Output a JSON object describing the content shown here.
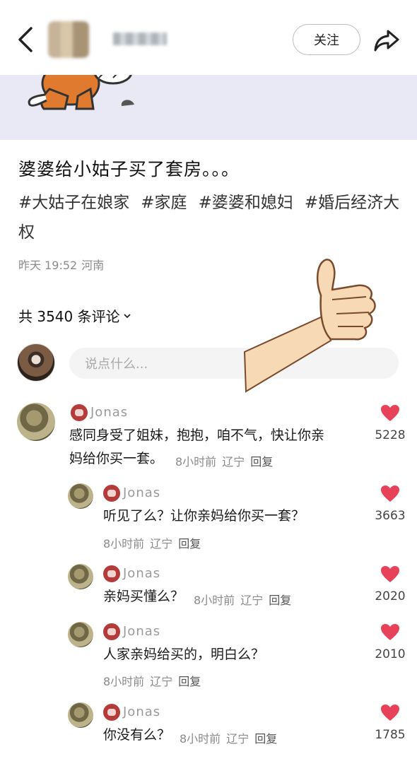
{
  "header": {
    "follow_label": "关注"
  },
  "post": {
    "title": "婆婆给小姑子买了套房。。。",
    "tags": [
      "#大姑子在娘家",
      "#家庭",
      "#婆婆和媳妇",
      "#婚后经济大权"
    ],
    "time": "昨天 19:52",
    "location": "河南"
  },
  "comments_header": {
    "label": "共 3540 条评论"
  },
  "comment_input": {
    "placeholder": "说点什么..."
  },
  "comments": [
    {
      "user": "Jonas",
      "text_line1": "感同身受了姐妹，抱抱，咱不气，快让你亲",
      "text_line2": "妈给你买一套。",
      "time": "8小时前",
      "location": "辽宁",
      "reply": "回复",
      "likes": "5228"
    },
    {
      "user": "Jonas",
      "text": "听见了么？让你亲妈给你买一套？",
      "time": "8小时前",
      "location": "辽宁",
      "reply": "回复",
      "likes": "3663"
    },
    {
      "user": "Jonas",
      "text": "亲妈买懂么？",
      "time": "8小时前",
      "location": "辽宁",
      "reply": "回复",
      "likes": "2020"
    },
    {
      "user": "Jonas",
      "text": "人家亲妈给买的，明白么？",
      "time": "8小时前",
      "location": "辽宁",
      "reply": "回复",
      "likes": "2010"
    },
    {
      "user": "Jonas",
      "text": "你没有么？",
      "time": "8小时前",
      "location": "辽宁",
      "reply": "回复",
      "likes": "1785"
    }
  ],
  "colors": {
    "heart": "#e8415a",
    "badge": "#b53a3a",
    "banner": "#e9e9f5"
  }
}
